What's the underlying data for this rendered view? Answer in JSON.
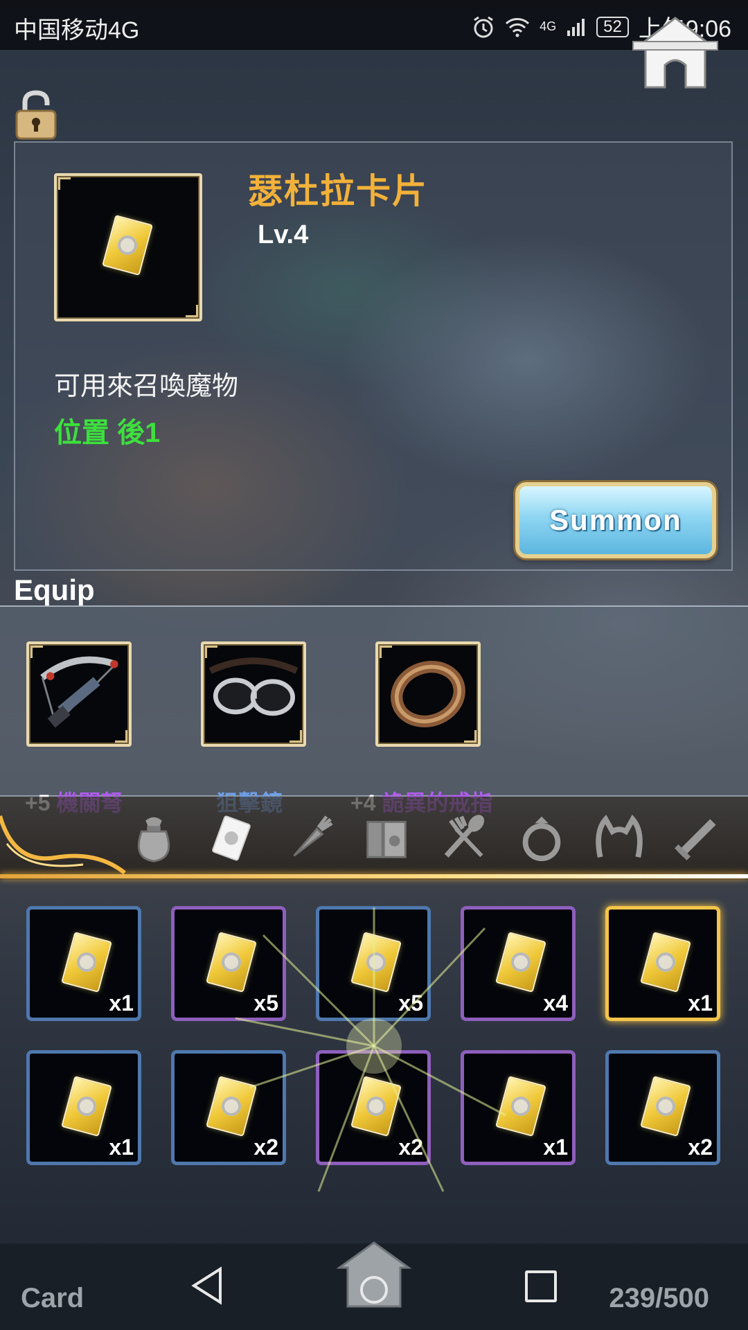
{
  "status_bar": {
    "carrier": "中国移动4G",
    "network": "4G",
    "battery": "52",
    "time": "上午9:06"
  },
  "item": {
    "title": "瑟杜拉卡片",
    "level": "Lv.4",
    "description": "可用來召喚魔物",
    "position": "位置 後1",
    "summon_label": "Summon",
    "icon": "card-icon"
  },
  "equip": {
    "label": "Equip",
    "slots": [
      {
        "plus": "+5",
        "name": "機關弩",
        "icon": "crossbow-icon",
        "rarity_color": "#b05cf0"
      },
      {
        "plus": "",
        "name": "狙擊鏡",
        "icon": "goggles-icon",
        "rarity_color": "#6fa0e8"
      },
      {
        "plus": "+4",
        "name": "詭異的戒指",
        "icon": "ring-icon",
        "rarity_color": "#b05cf0"
      }
    ]
  },
  "tabs": [
    {
      "name": "bag",
      "icon": "bag-icon",
      "active": false
    },
    {
      "name": "card",
      "icon": "card-icon",
      "active": true
    },
    {
      "name": "material",
      "icon": "carrot-icon",
      "active": false
    },
    {
      "name": "book",
      "icon": "book-icon",
      "active": false
    },
    {
      "name": "food",
      "icon": "spoon-fork-icon",
      "active": false
    },
    {
      "name": "ring",
      "icon": "ring-icon",
      "active": false
    },
    {
      "name": "headwear",
      "icon": "headband-icon",
      "active": false
    },
    {
      "name": "weapon",
      "icon": "sword-icon",
      "active": false
    }
  ],
  "inventory": [
    {
      "count": "x1",
      "rarity": "blue",
      "selected": false
    },
    {
      "count": "x5",
      "rarity": "purple",
      "selected": false
    },
    {
      "count": "x5",
      "rarity": "blue",
      "selected": false
    },
    {
      "count": "x4",
      "rarity": "purple",
      "selected": false
    },
    {
      "count": "x1",
      "rarity": "gold",
      "selected": true
    },
    {
      "count": "x1",
      "rarity": "blue",
      "selected": false
    },
    {
      "count": "x2",
      "rarity": "blue",
      "selected": false
    },
    {
      "count": "x2",
      "rarity": "purple",
      "selected": false
    },
    {
      "count": "x1",
      "rarity": "purple",
      "selected": false
    },
    {
      "count": "x2",
      "rarity": "blue",
      "selected": false
    }
  ],
  "footer": {
    "category": "Card",
    "capacity": "239/500"
  },
  "colors": {
    "title_orange": "#f2b13a",
    "position_green": "#3de03d",
    "selected_gold": "#f4c44a",
    "rarity_blue": "#4f78ad",
    "rarity_purple": "#8e5fbc"
  }
}
